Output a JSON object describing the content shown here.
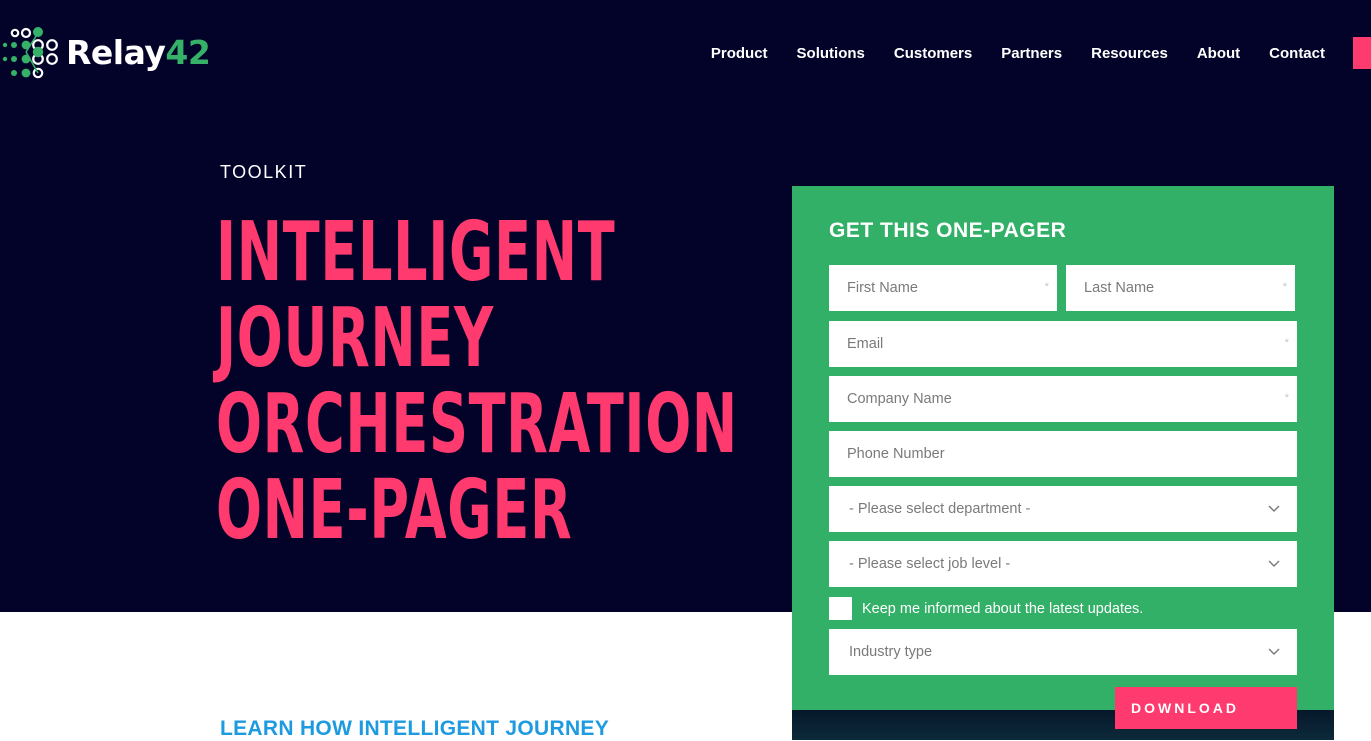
{
  "brand": {
    "logo_text_primary": "Relay",
    "logo_text_accent": "42",
    "logo_icon": "relay42-dots-icon",
    "colors": {
      "background_dark": "#03032a",
      "accent_pink": "#ff3a6e",
      "accent_green": "#33b067",
      "link_blue": "#1e9be0"
    }
  },
  "nav": {
    "items": [
      {
        "label": "Product"
      },
      {
        "label": "Solutions"
      },
      {
        "label": "Customers"
      },
      {
        "label": "Partners"
      },
      {
        "label": "Resources"
      },
      {
        "label": "About"
      },
      {
        "label": "Contact"
      }
    ]
  },
  "hero": {
    "eyebrow": "TOOLKIT",
    "title_lines": [
      "INTELLIGENT",
      "JOURNEY",
      "ORCHESTRATION",
      "ONE-PAGER"
    ]
  },
  "section": {
    "subheading": "LEARN HOW INTELLIGENT JOURNEY"
  },
  "form": {
    "title": "GET THIS ONE-PAGER",
    "fields": {
      "first_name": {
        "placeholder": "First Name",
        "value": "",
        "required_mark": "*"
      },
      "last_name": {
        "placeholder": "Last Name",
        "value": "",
        "required_mark": "*"
      },
      "email": {
        "placeholder": "Email",
        "value": "",
        "required_mark": "*"
      },
      "company": {
        "placeholder": "Company Name",
        "value": "",
        "required_mark": "*"
      },
      "phone": {
        "placeholder": "Phone Number",
        "value": ""
      }
    },
    "selects": {
      "department": {
        "selected": "- Please select department -"
      },
      "job_level": {
        "selected": "- Please select job level -"
      },
      "industry": {
        "selected": "Industry type"
      }
    },
    "checkbox": {
      "label": "Keep me informed about the latest updates.",
      "checked": false
    },
    "submit_label": "DOWNLOAD"
  }
}
